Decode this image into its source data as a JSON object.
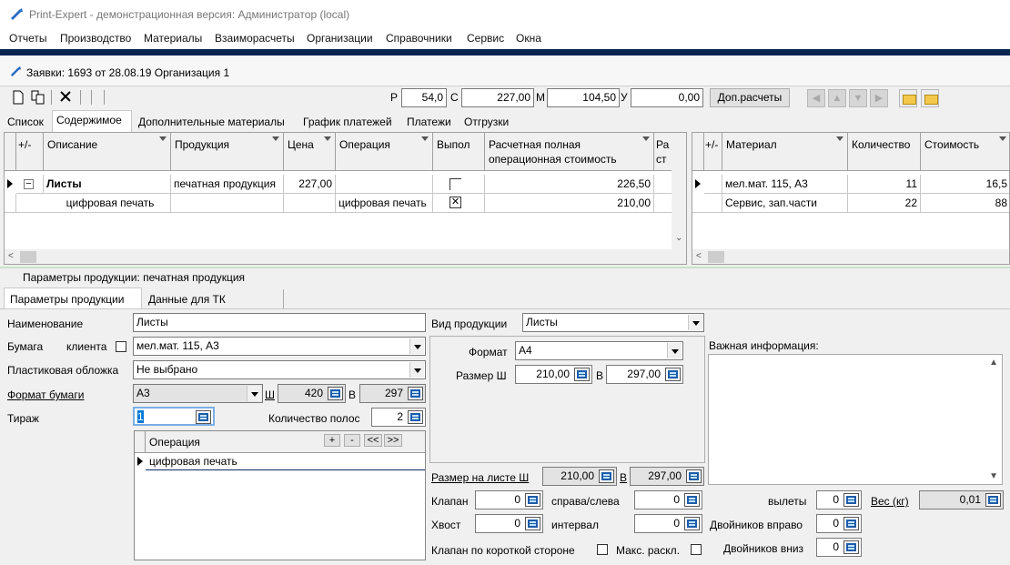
{
  "window": {
    "title": "Print-Expert - демонстрационная версия: Администратор (local)"
  },
  "menu": [
    "Отчеты",
    "Производство",
    "Материалы",
    "Взаиморасчеты",
    "Организации",
    "Справочники",
    "Сервис",
    "Окна"
  ],
  "doc": {
    "title": "Заявки: 1693 от 28.08.19  Организация 1"
  },
  "toolbar": {
    "p_label": "Р",
    "p_value": "54,0",
    "c_label": "С",
    "c_value": "227,00",
    "m_label": "М",
    "m_value": "104,50",
    "u_label": "У",
    "u_value": "0,00",
    "dop_button": "Доп.расчеты"
  },
  "tabs": [
    "Список",
    "Содержимое",
    "Дополнительные материалы",
    "График платежей",
    "Платежи",
    "Отгрузки"
  ],
  "content_grid": {
    "headers": {
      "plusminus": "+/-",
      "description": "Описание",
      "product": "Продукция",
      "price": "Цена",
      "operation": "Операция",
      "done": "Выпол",
      "calc": "Расчетная полная операционная стоимость",
      "extra": "Ра ст"
    },
    "rows": [
      {
        "description": "Листы",
        "product": "печатная продукция",
        "price": "227,00",
        "operation": "",
        "done": false,
        "calc": "226,50"
      },
      {
        "description": "цифровая печать",
        "product": "",
        "price": "",
        "operation": "цифровая печать",
        "done": true,
        "calc": "210,00"
      }
    ]
  },
  "material_grid": {
    "headers": {
      "plusminus": "+/-",
      "material": "Материал",
      "quantity": "Количество",
      "cost": "Стоимость"
    },
    "rows": [
      {
        "material": "мел.мат. 115, А3",
        "quantity": "11",
        "cost": "16,5"
      },
      {
        "material": "Сервис, зап.части",
        "quantity": "22",
        "cost": "88"
      }
    ]
  },
  "params": {
    "caption": "Параметры продукции: печатная продукция",
    "tabs": [
      "Параметры продукции",
      "Данные для ТК"
    ],
    "name_label": "Наименование",
    "name_value": "Листы",
    "paper_label": "Бумага",
    "client_label": "клиента",
    "paper_value": "мел.мат. 115, А3",
    "cover_label": "Пластиковая обложка",
    "cover_value": "Не выбрано",
    "format_label": "Формат бумаги",
    "format_value": "А3",
    "w_label": "Ш",
    "w_value": "420",
    "h_label": "В",
    "h_value": "297",
    "tirazh_label": "Тираж",
    "tirazh_value": "1",
    "stripes_label": "Количество полос",
    "stripes_value": "2",
    "ops_header": "Операция",
    "ops_btns": [
      "+",
      "-",
      "<<",
      ">>"
    ],
    "ops_rows": [
      "цифровая печать"
    ],
    "kind_label": "Вид продукции",
    "kind_value": "Листы",
    "fmt_label": "Формат",
    "fmt_value": "А4",
    "size_label": "Размер Ш",
    "size_w": "210,00",
    "size_h_label": "В",
    "size_h": "297,00",
    "important_label": "Важная информация:",
    "sheet_label": "Размер на листе Ш",
    "sheet_w": "210,00",
    "sheet_h_label": "В",
    "sheet_h": "297,00",
    "klapan_label": "Клапан",
    "klapan_value": "0",
    "right_left_label": "справа/слева",
    "right_left_value": "0",
    "vylety_label": "вылеты",
    "vylety_value": "0",
    "weight_label": "Вес (кг)",
    "weight_value": "0,01",
    "tail_label": "Хвост",
    "tail_value": "0",
    "interval_label": "интервал",
    "interval_value": "0",
    "twins_right_label": "Двойников вправо",
    "twins_right_value": "0",
    "short_side_label": "Клапан по короткой стороне",
    "max_label": "Макс. раскл.",
    "twins_down_label": "Двойников вниз",
    "twins_down_value": "0"
  }
}
